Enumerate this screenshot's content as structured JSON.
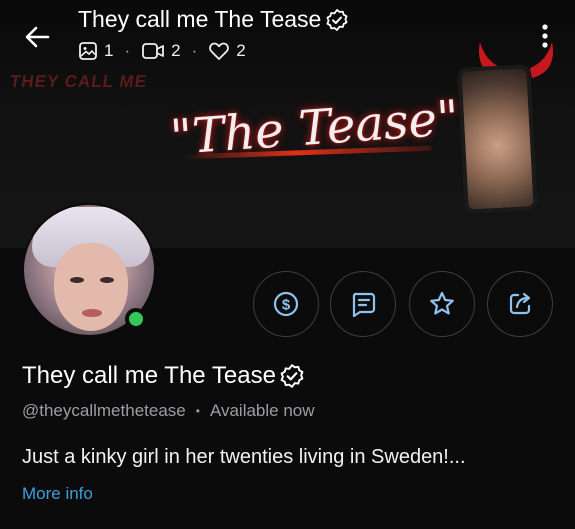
{
  "banner": {
    "small_text": "THEY CALL ME",
    "script_text": "\"The Tease\""
  },
  "topbar": {
    "back_icon": "arrow-left-icon",
    "title": "They call me The Tease",
    "verified_icon": "verified-badge-icon",
    "menu_icon": "more-vertical-icon",
    "stats": {
      "photos": "1",
      "videos": "2",
      "likes": "2"
    },
    "separator": "·"
  },
  "profile": {
    "name": "They call me The Tease",
    "handle": "@theycallmethetease",
    "status_separator": "•",
    "status": "Available now",
    "bio": "Just a kinky girl in her twenties living in Sweden!...",
    "more_info": "More info",
    "online_color": "#34c759"
  },
  "actions": [
    {
      "icon": "dollar-tip-icon"
    },
    {
      "icon": "message-icon"
    },
    {
      "icon": "star-icon"
    },
    {
      "icon": "share-icon"
    }
  ],
  "colors": {
    "accent": "#3f9dd8",
    "icon": "#8ec3f0",
    "background": "#0b0b0c"
  }
}
